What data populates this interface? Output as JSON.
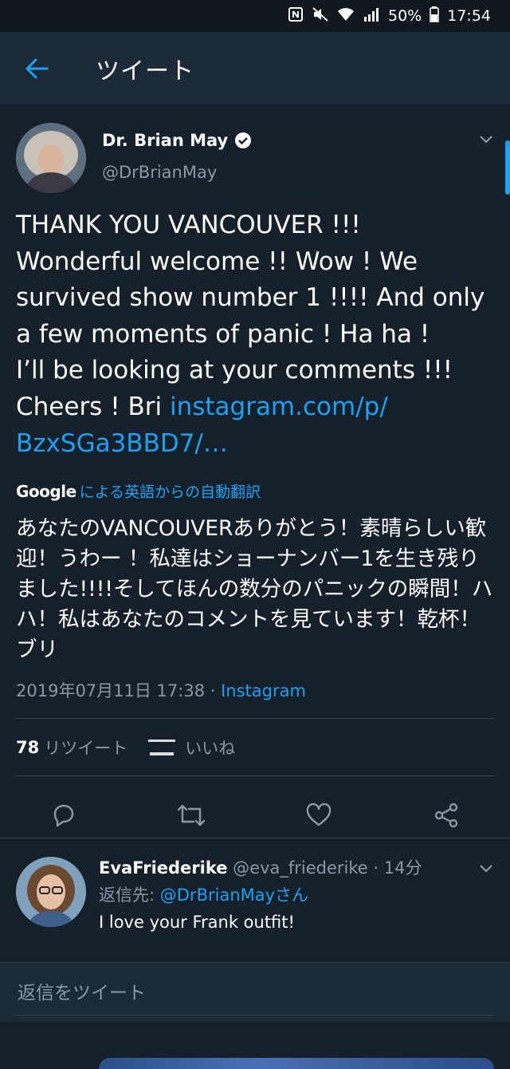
{
  "status_bar": {
    "battery": "50%",
    "time": "17:54"
  },
  "header": {
    "title": "ツイート"
  },
  "tweet": {
    "author_name": "Dr. Brian May",
    "author_handle": "@DrBrianMay",
    "text_lines": [
      "THANK YOU VANCOUVER !!!",
      "Wonderful welcome !! Wow ! We",
      "survived show number 1 !!!! And only",
      "a few moments of panic ! Ha ha !",
      "I’ll be looking at your comments !!!",
      "Cheers ! Bri "
    ],
    "link_part1": "instagram.com/p/",
    "link_part2": "BzxSGa3BBD7/…",
    "translation_brand": "Google",
    "translation_label": "による英語からの自動翻訳",
    "translated_text": "あなたのVANCOUVERありがとう！素晴らしい歓迎！うわー ！私達はショーナンバー1を生き残りました!!!!そしてほんの数分のパニックの瞬間！ハハ！私はあなたのコメントを見ています！乾杯！ブリ",
    "timestamp": "2019年07月11日 17:38 · ",
    "source": "Instagram",
    "retweet_count": "78",
    "retweet_label": "リツイート",
    "like_label": "いいね"
  },
  "reply": {
    "name": "EvaFriederike",
    "handle_time": " @eva_friederike · 14分",
    "reply_to_label": "返信先: ",
    "reply_to_mention": "@DrBrianMayさん",
    "text": "I love your Frank outfit!"
  },
  "composer": {
    "placeholder": "返信をツイート"
  },
  "colors": {
    "background": "#15202b",
    "accent": "#1da1f2",
    "secondary_text": "#8899a6"
  }
}
